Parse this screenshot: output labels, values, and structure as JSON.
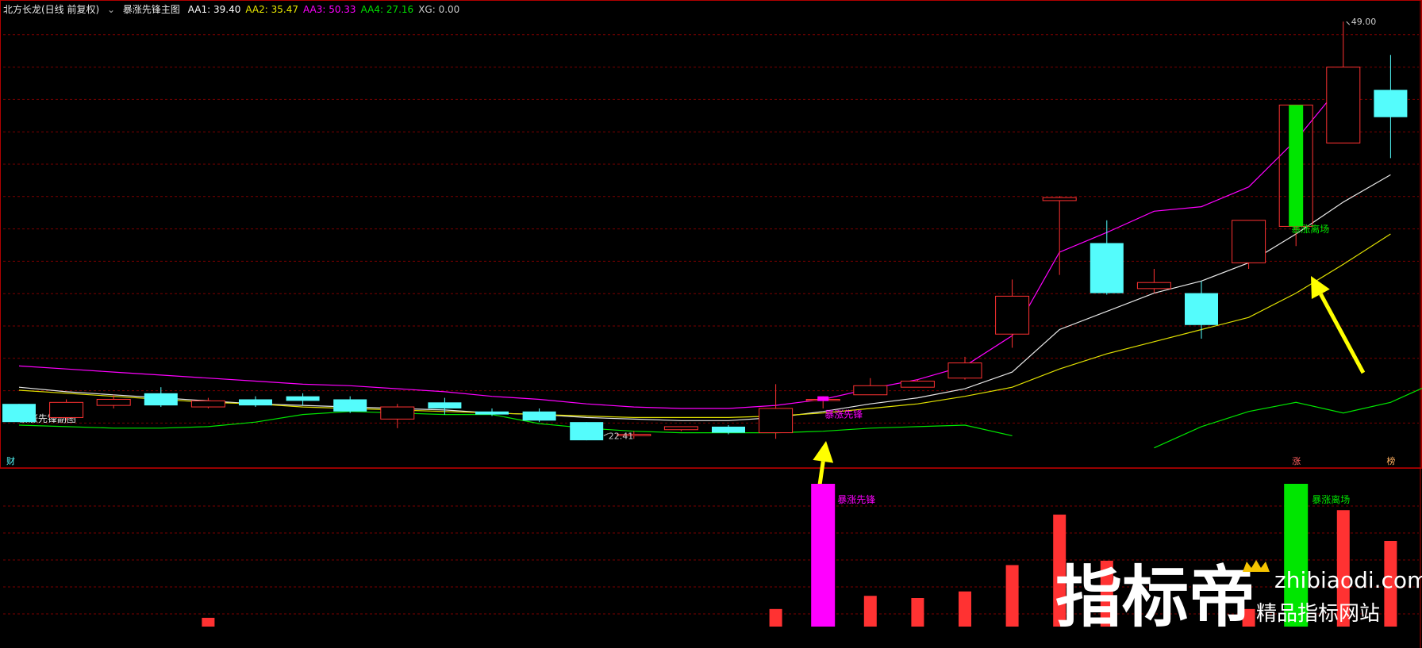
{
  "main_title": "北方长龙(日线 前复权)",
  "main_indicator_name": "暴涨先锋主图",
  "main_header": [
    {
      "text": "AA1: 39.40",
      "color": "#ffffff"
    },
    {
      "text": "AA2: 35.47",
      "color": "#e8e800"
    },
    {
      "text": "AA3: 50.33",
      "color": "#ff00ff"
    },
    {
      "text": "AA4: 27.16",
      "color": "#00e000"
    },
    {
      "text": "XG: 0.00",
      "color": "#c8c8c8"
    }
  ],
  "sub_indicator_name": "暴涨先锋副图",
  "price_high_label": "49.00",
  "price_low_label": "22.41",
  "signal_buy_label": "暴涨先锋",
  "signal_exit_label": "暴涨离场",
  "sub_buy_label": "暴涨先锋",
  "sub_exit_label": "暴涨离场",
  "bottom_markers": [
    "财",
    "涨",
    "榜"
  ],
  "watermark_main": "指标帝",
  "watermark_domain": "zhibiaodi.com",
  "watermark_sub": "精品指标网站",
  "colors": {
    "up": "#ff3232",
    "down": "#54fcfc",
    "magenta": "#ff00ff",
    "green": "#00e600",
    "white": "#e8e8e8",
    "yellow": "#e0e000",
    "arrow": "#ffff00",
    "grid": "#7a0000",
    "frame": "#b00000"
  },
  "chart_data": {
    "type": "candlestick",
    "ylim": [
      20.6,
      50.4
    ],
    "candles": [
      {
        "o": 24.3,
        "c": 23.1,
        "h": 24.3,
        "l": 23.1,
        "type": "down"
      },
      {
        "o": 23.4,
        "c": 24.4,
        "h": 24.6,
        "l": 23.2,
        "type": "up"
      },
      {
        "o": 24.2,
        "c": 24.6,
        "h": 24.9,
        "l": 24.0,
        "type": "up"
      },
      {
        "o": 25.0,
        "c": 24.2,
        "h": 25.4,
        "l": 24.1,
        "type": "down"
      },
      {
        "o": 24.1,
        "c": 24.5,
        "h": 24.7,
        "l": 24.0,
        "type": "up"
      },
      {
        "o": 24.6,
        "c": 24.2,
        "h": 24.8,
        "l": 24.1,
        "type": "down"
      },
      {
        "o": 24.8,
        "c": 24.5,
        "h": 25.0,
        "l": 24.2,
        "type": "down"
      },
      {
        "o": 24.6,
        "c": 23.8,
        "h": 24.8,
        "l": 23.7,
        "type": "down"
      },
      {
        "o": 23.3,
        "c": 24.1,
        "h": 24.3,
        "l": 22.7,
        "type": "up"
      },
      {
        "o": 24.4,
        "c": 24.0,
        "h": 24.7,
        "l": 23.6,
        "type": "down"
      },
      {
        "o": 23.8,
        "c": 23.6,
        "h": 24.0,
        "l": 23.5,
        "type": "down"
      },
      {
        "o": 23.8,
        "c": 23.2,
        "h": 24.0,
        "l": 23.1,
        "type": "down"
      },
      {
        "o": 23.1,
        "c": 21.9,
        "h": 23.1,
        "l": 21.9,
        "type": "down"
      },
      {
        "o": 22.2,
        "c": 22.3,
        "h": 22.5,
        "l": 22.0,
        "type": "up"
      },
      {
        "o": 22.6,
        "c": 22.8,
        "h": 22.8,
        "l": 22.5,
        "type": "up"
      },
      {
        "o": 22.8,
        "c": 22.4,
        "h": 22.9,
        "l": 22.3,
        "type": "down"
      },
      {
        "o": 22.4,
        "c": 24.0,
        "h": 25.6,
        "l": 22.0,
        "type": "up"
      },
      {
        "o": 24.6,
        "c": 24.6,
        "h": 24.8,
        "l": 24.0,
        "type": "up"
      },
      {
        "o": 24.9,
        "c": 25.5,
        "h": 26.0,
        "l": 24.9,
        "type": "up"
      },
      {
        "o": 25.4,
        "c": 25.8,
        "h": 25.9,
        "l": 25.4,
        "type": "up"
      },
      {
        "o": 26.0,
        "c": 27.0,
        "h": 27.4,
        "l": 25.9,
        "type": "up"
      },
      {
        "o": 28.9,
        "c": 31.4,
        "h": 32.5,
        "l": 28.0,
        "type": "up"
      },
      {
        "o": 37.7,
        "c": 37.9,
        "h": 38.0,
        "l": 32.8,
        "type": "up"
      },
      {
        "o": 34.9,
        "c": 31.6,
        "h": 36.4,
        "l": 31.5,
        "type": "down"
      },
      {
        "o": 31.9,
        "c": 32.3,
        "h": 33.2,
        "l": 31.6,
        "type": "up"
      },
      {
        "o": 31.6,
        "c": 29.5,
        "h": 32.4,
        "l": 28.6,
        "type": "down"
      },
      {
        "o": 33.6,
        "c": 36.4,
        "h": 36.4,
        "l": 33.2,
        "type": "up"
      },
      {
        "o": 44.0,
        "c": 36.0,
        "h": 44.0,
        "l": 34.7,
        "type": "exit"
      },
      {
        "o": 41.5,
        "c": 46.5,
        "h": 49.5,
        "l": 41.5,
        "type": "up"
      },
      {
        "o": 45.0,
        "c": 43.2,
        "h": 47.3,
        "l": 40.5,
        "type": "down"
      }
    ],
    "lines": [
      {
        "name": "AA3",
        "color": "#ff00ff",
        "values": [
          26.8,
          26.6,
          26.4,
          26.2,
          26.0,
          25.8,
          25.6,
          25.5,
          25.3,
          25.1,
          24.8,
          24.6,
          24.3,
          24.1,
          24.0,
          24.0,
          24.2,
          24.6,
          25.3,
          25.9,
          26.8,
          28.8,
          34.3,
          35.6,
          37.0,
          37.3,
          38.6,
          41.7,
          45.5,
          null
        ]
      },
      {
        "name": "AA1",
        "color": "#e8e8e8",
        "values": [
          25.4,
          25.1,
          24.9,
          24.7,
          24.5,
          24.3,
          24.2,
          24.1,
          24.0,
          23.9,
          23.7,
          23.6,
          23.4,
          23.3,
          23.2,
          23.2,
          23.4,
          23.8,
          24.3,
          24.7,
          25.3,
          26.4,
          29.2,
          30.4,
          31.6,
          32.4,
          33.6,
          35.5,
          37.6,
          39.4
        ]
      },
      {
        "name": "AA2",
        "color": "#e0e000",
        "values": [
          25.2,
          25.0,
          24.8,
          24.6,
          24.4,
          24.3,
          24.1,
          24.0,
          23.9,
          23.8,
          23.7,
          23.6,
          23.5,
          23.4,
          23.4,
          23.4,
          23.5,
          23.7,
          24.0,
          24.3,
          24.8,
          25.4,
          26.6,
          27.6,
          28.4,
          29.2,
          30.0,
          31.6,
          33.5,
          35.5
        ]
      },
      {
        "name": "AA4",
        "color": "#00e600",
        "values": [
          22.9,
          22.8,
          22.7,
          22.7,
          22.8,
          23.1,
          23.6,
          23.8,
          23.7,
          23.6,
          23.6,
          23.0,
          22.7,
          22.5,
          22.4,
          22.4,
          22.4,
          22.5,
          22.7,
          22.8,
          22.9,
          22.2,
          null,
          null,
          21.4,
          22.8,
          23.8,
          24.4,
          23.7,
          24.4,
          25.8
        ]
      }
    ],
    "sub_bars": [
      {
        "v": 0,
        "c": "red"
      },
      {
        "v": 0,
        "c": "red"
      },
      {
        "v": 0,
        "c": "red"
      },
      {
        "v": 0,
        "c": "red"
      },
      {
        "v": 4,
        "c": "red"
      },
      {
        "v": 0,
        "c": "red"
      },
      {
        "v": 0,
        "c": "red"
      },
      {
        "v": 0,
        "c": "red"
      },
      {
        "v": 0,
        "c": "red"
      },
      {
        "v": 0,
        "c": "red"
      },
      {
        "v": 0,
        "c": "red"
      },
      {
        "v": 0,
        "c": "red"
      },
      {
        "v": 0,
        "c": "red"
      },
      {
        "v": 0,
        "c": "red"
      },
      {
        "v": 0,
        "c": "red"
      },
      {
        "v": 0,
        "c": "red"
      },
      {
        "v": 8,
        "c": "red"
      },
      {
        "v": 65,
        "c": "magenta"
      },
      {
        "v": 14,
        "c": "red"
      },
      {
        "v": 13,
        "c": "red"
      },
      {
        "v": 16,
        "c": "red"
      },
      {
        "v": 28,
        "c": "red"
      },
      {
        "v": 51,
        "c": "red"
      },
      {
        "v": 30,
        "c": "red"
      },
      {
        "v": 0,
        "c": "red"
      },
      {
        "v": 0,
        "c": "red"
      },
      {
        "v": 8,
        "c": "red"
      },
      {
        "v": 65,
        "c": "green"
      },
      {
        "v": 53,
        "c": "red"
      },
      {
        "v": 39,
        "c": "red"
      }
    ]
  }
}
